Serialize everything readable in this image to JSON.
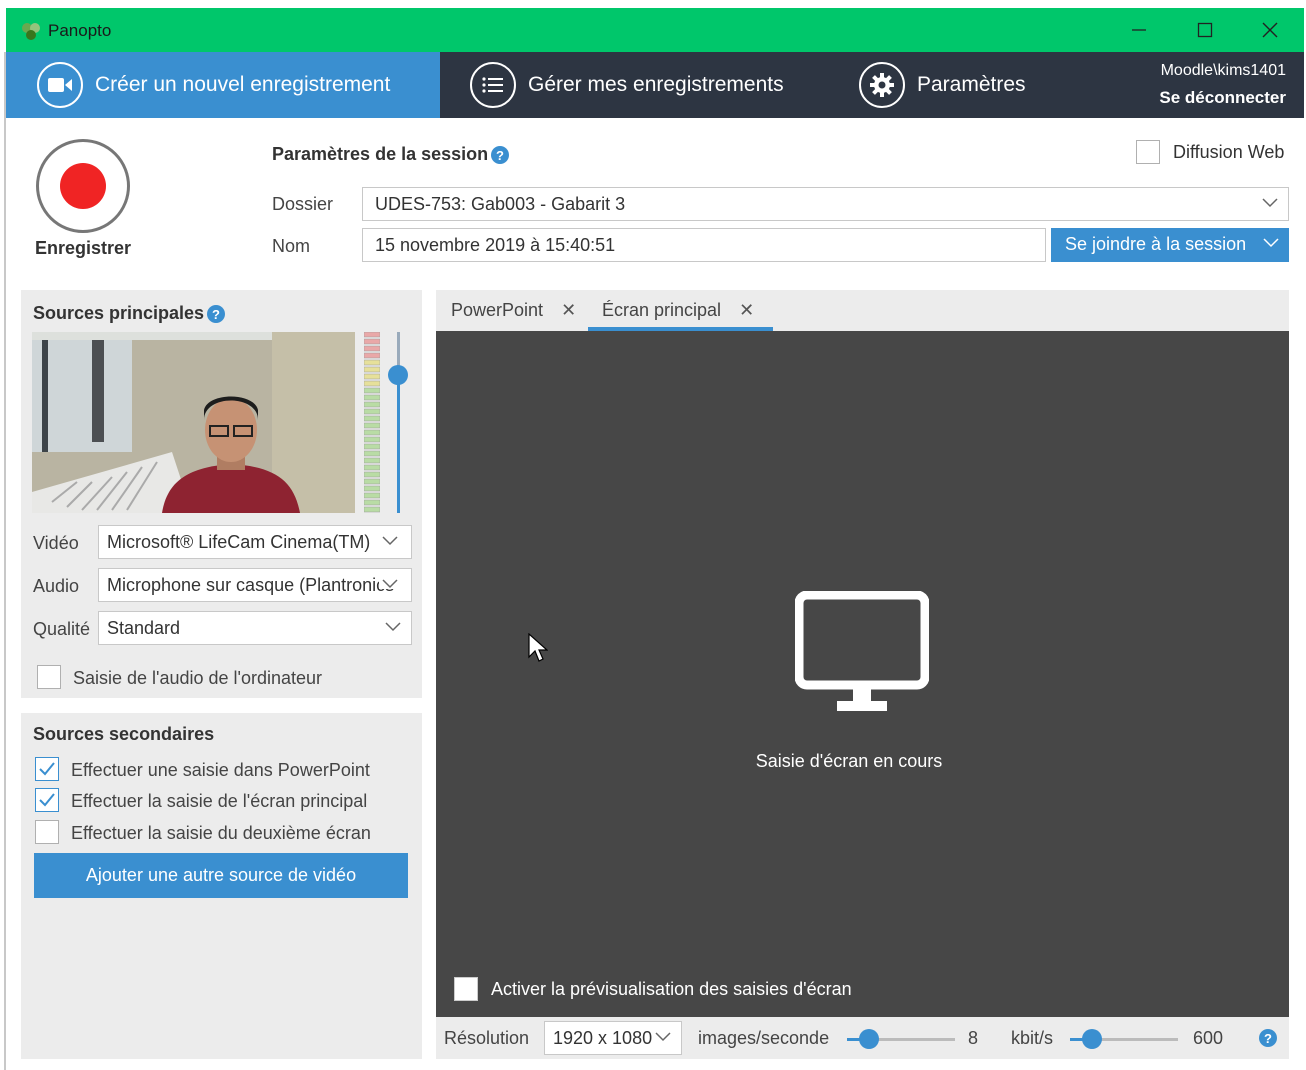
{
  "window": {
    "title": "Panopto",
    "minimize_icon": "minimize-icon",
    "maximize_icon": "maximize-icon",
    "close_icon": "close-icon"
  },
  "nav": {
    "tabs": [
      {
        "label": "Créer un nouvel enregistrement",
        "icon": "camera-icon",
        "active": true
      },
      {
        "label": "Gérer mes enregistrements",
        "icon": "list-icon",
        "active": false
      },
      {
        "label": "Paramètres",
        "icon": "gear-icon",
        "active": false
      }
    ],
    "user": "Moodle\\kims1401",
    "logout": "Se déconnecter"
  },
  "record": {
    "label": "Enregistrer"
  },
  "session": {
    "title": "Paramètres de la session",
    "webcast_label": "Diffusion Web",
    "webcast_checked": false,
    "folder_label": "Dossier",
    "folder_value": "UDES-753: Gab003 - Gabarit 3",
    "name_label": "Nom",
    "name_value": "15 novembre 2019 à 15:40:51",
    "join_label": "Se joindre à la session"
  },
  "primary": {
    "title": "Sources principales",
    "video_label": "Vidéo",
    "video_value": "Microsoft® LifeCam Cinema(TM)",
    "audio_label": "Audio",
    "audio_value": "Microphone sur casque (Plantronics",
    "quality_label": "Qualité",
    "quality_value": "Standard",
    "pc_audio_label": "Saisie de l'audio de l'ordinateur",
    "pc_audio_checked": false
  },
  "secondary": {
    "title": "Sources secondaires",
    "options": [
      {
        "label": "Effectuer une saisie dans PowerPoint",
        "checked": true
      },
      {
        "label": "Effectuer la saisie de l'écran principal",
        "checked": true
      },
      {
        "label": "Effectuer la saisie du deuxième écran",
        "checked": false
      }
    ],
    "add_button": "Ajouter une autre source de vidéo"
  },
  "preview": {
    "tabs": [
      {
        "label": "PowerPoint",
        "active": false
      },
      {
        "label": "Écran principal",
        "active": true
      }
    ],
    "status": "Saisie d'écran en cours",
    "preview_toggle_label": "Activer la prévisualisation des saisies d'écran",
    "preview_toggle_checked": false
  },
  "bottom": {
    "resolution_label": "Résolution",
    "resolution_value": "1920 x 1080",
    "fps_label": "images/seconde",
    "fps_value": "8",
    "fps_fraction": 0.2,
    "kbps_label": "kbit/s",
    "kbps_value": "600",
    "kbps_fraction": 0.2
  },
  "colors": {
    "titlebar": "#00c76b",
    "nav_bg": "#2d3542",
    "accent": "#3a8fd0",
    "record": "#f02424",
    "preview_bg": "#474747"
  }
}
